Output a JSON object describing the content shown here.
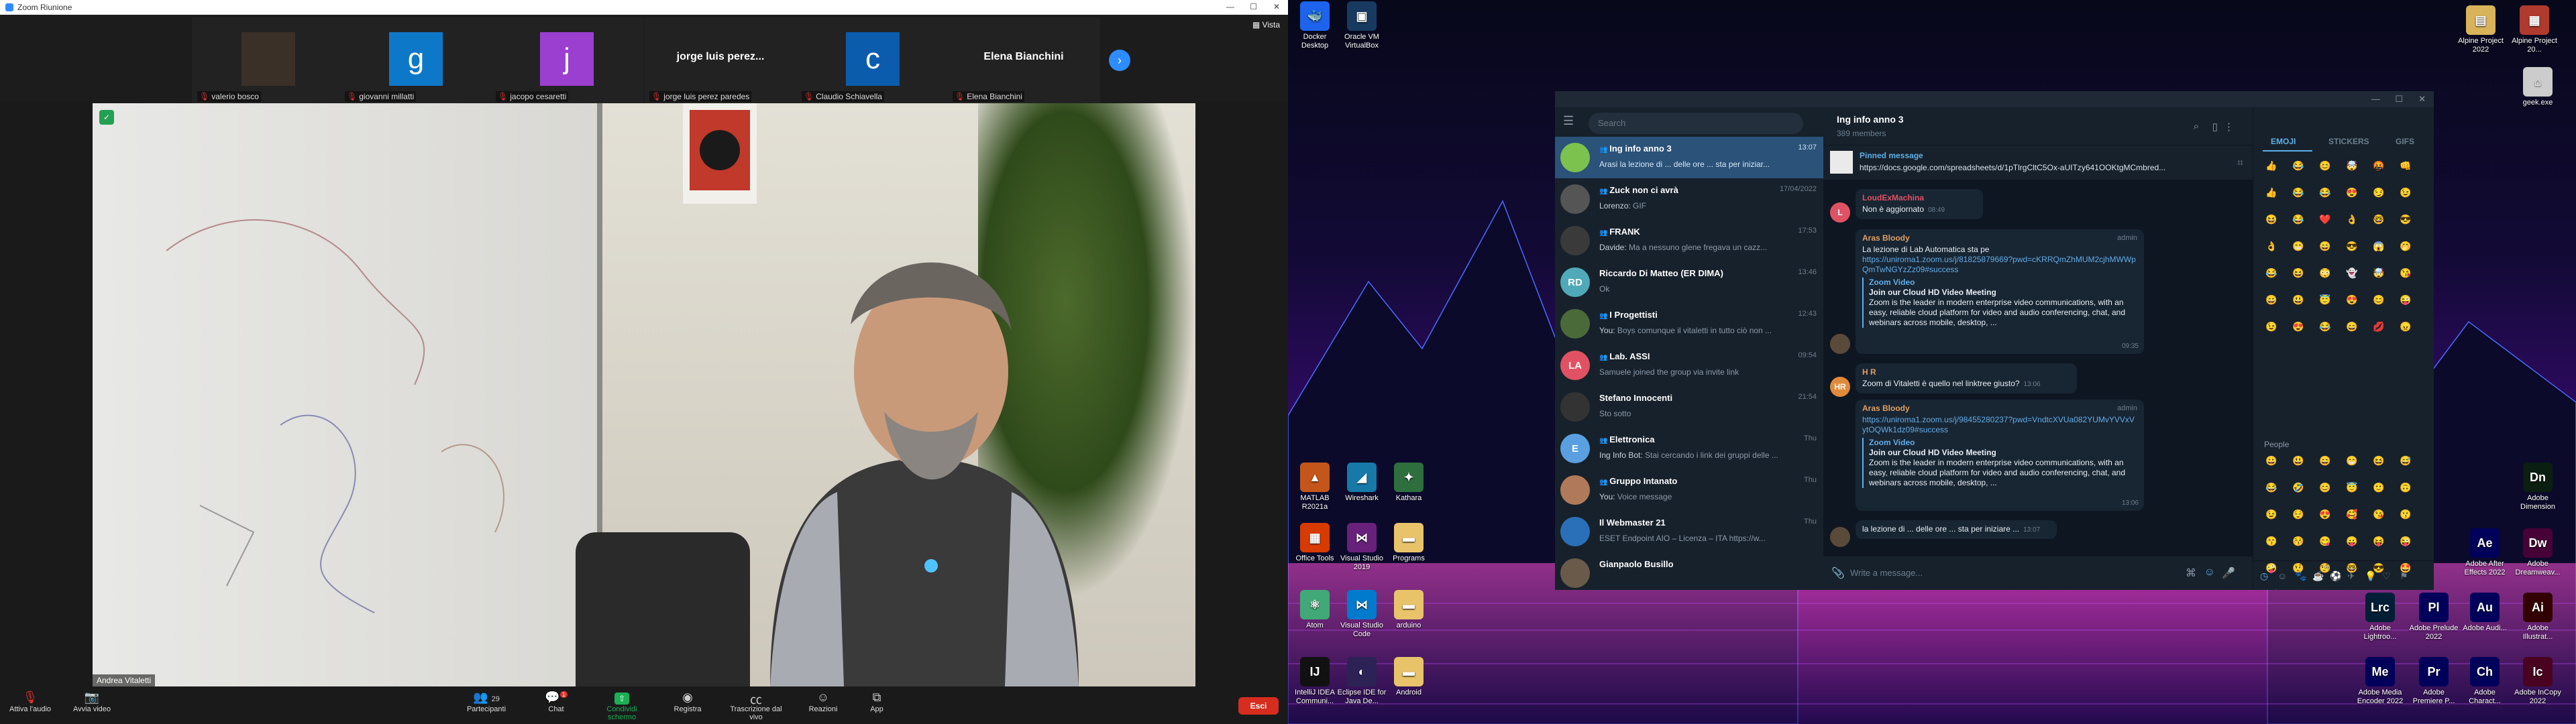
{
  "zoom": {
    "window_title": "Zoom Riunione",
    "view_label": "Vista",
    "participants": [
      {
        "name": "valerio bosco",
        "kind": "photo",
        "color": "#3a3028",
        "initial": ""
      },
      {
        "name": "giovanni millatti",
        "kind": "avatar",
        "color": "#0e78c8",
        "initial": "g"
      },
      {
        "name": "jacopo cesaretti",
        "kind": "avatar",
        "color": "#9b3fd1",
        "initial": "j"
      },
      {
        "name": "jorge luis perez paredes",
        "kind": "text",
        "big": "jorge  luis  perez...",
        "color": "#222"
      },
      {
        "name": "Claudio Schiavella",
        "kind": "avatar",
        "color": "#0b5cad",
        "initial": "c"
      },
      {
        "name": "Elena Bianchini",
        "kind": "text",
        "big": "Elena Bianchini",
        "color": "#222"
      }
    ],
    "speaker_name": "Andrea Vitaletti",
    "toolbar": {
      "audio": "Attiva l'audio",
      "video": "Avvia video",
      "participants": "Partecipanti",
      "participants_count": "29",
      "chat": "Chat",
      "chat_badge": "1",
      "share": "Condividi schermo",
      "record": "Registra",
      "transcript": "Trascrizione dal vivo",
      "reactions": "Reazioni",
      "apps": "App",
      "exit": "Esci"
    }
  },
  "desktop": {
    "icons_left": [
      {
        "label": "Docker Desktop",
        "glyph": "🐳",
        "color": "#1d63ed"
      },
      {
        "label": "Oracle VM VirtualBox",
        "glyph": "▣",
        "color": "#183a61"
      },
      {
        "label": "MATLAB R2021a",
        "glyph": "▲",
        "color": "#c4561b"
      },
      {
        "label": "Wireshark",
        "glyph": "◢",
        "color": "#1679a7"
      },
      {
        "label": "Kathara",
        "glyph": "✦",
        "color": "#2f6f3e"
      },
      {
        "label": "Office Tools",
        "glyph": "▦",
        "color": "#d83b01"
      },
      {
        "label": "Visual Studio 2019",
        "glyph": "⋈",
        "color": "#68217a"
      },
      {
        "label": "Programs",
        "glyph": "▬",
        "color": "#e8c36a"
      },
      {
        "label": "Atom",
        "glyph": "⚛",
        "color": "#40a977"
      },
      {
        "label": "Visual Studio Code",
        "glyph": "⋈",
        "color": "#007acc"
      },
      {
        "label": "arduino",
        "glyph": "▬",
        "color": "#e8c36a"
      },
      {
        "label": "IntelliJ IDEA Communi...",
        "glyph": "IJ",
        "color": "#111"
      },
      {
        "label": "Eclipse IDE for Java De...",
        "glyph": "◐",
        "color": "#2c2255"
      },
      {
        "label": "Android",
        "glyph": "▬",
        "color": "#e8c36a"
      }
    ],
    "icons_right": [
      {
        "label": "Alpine Project 2022",
        "glyph": "▤",
        "color": "#d9b35a"
      },
      {
        "label": "Alpine Project 20...",
        "glyph": "▦",
        "color": "#b03a2e"
      },
      {
        "label": "geek.exe",
        "glyph": "⌂",
        "color": "#ccc"
      },
      {
        "label": "Adobe Dimension",
        "glyph": "Dn",
        "color": "#0a1f0f"
      },
      {
        "label": "Adobe After Effects 2022",
        "glyph": "Ae",
        "color": "#00005b"
      },
      {
        "label": "Adobe Dreamweav...",
        "glyph": "Dw",
        "color": "#470137"
      },
      {
        "label": "Adobe Lightroo...",
        "glyph": "Lrc",
        "color": "#001e36"
      },
      {
        "label": "Adobe Prelude 2022",
        "glyph": "Pl",
        "color": "#00005b"
      },
      {
        "label": "Adobe Audi...",
        "glyph": "Au",
        "color": "#00005b"
      },
      {
        "label": "Adobe Illustrat...",
        "glyph": "Ai",
        "color": "#330000"
      },
      {
        "label": "Adobe Media Encoder 2022",
        "glyph": "Me",
        "color": "#00005b"
      },
      {
        "label": "Adobe Premiere P...",
        "glyph": "Pr",
        "color": "#00005b"
      },
      {
        "label": "Adobe Charact...",
        "glyph": "Ch",
        "color": "#00005b"
      },
      {
        "label": "Adobe InCopy 2022",
        "glyph": "Ic",
        "color": "#49021f"
      }
    ]
  },
  "telegram": {
    "search_placeholder": "Search",
    "chats": [
      {
        "title": "Ing info anno 3",
        "time": "13:07",
        "preview": "Arasi la lezione di ... delle ore ... sta per iniziar...",
        "sender": "",
        "color": "#7cc24e",
        "initial": "",
        "active": true,
        "group": true
      },
      {
        "title": "Zuck non ci avrà",
        "time": "17/04/2022",
        "sender": "Lorenzo:",
        "preview": " GIF",
        "color": "#555",
        "initial": "",
        "active": false,
        "group": true
      },
      {
        "title": "FRANK",
        "time": "17:53",
        "sender": "Davide:",
        "preview": " Ma a nessuno glene fregava un cazz...",
        "color": "#3a3a3a",
        "initial": "",
        "active": false,
        "group": true
      },
      {
        "title": "Riccardo Di Matteo (ER DIMA)",
        "time": "13:46",
        "sender": "",
        "preview": "Ok",
        "color": "#4fa9b8",
        "initial": "RD",
        "active": false,
        "group": false
      },
      {
        "title": "I Progettisti",
        "time": "12:43",
        "sender": "You:",
        "preview": " Boys comunque il vitaletti in tutto ciò non ...",
        "color": "#4a6a3a",
        "initial": "",
        "active": false,
        "group": true
      },
      {
        "title": "Lab. ASSI",
        "time": "09:54",
        "sender": "",
        "preview": "Samuele joined the group via invite link",
        "color": "#e05263",
        "initial": "LA",
        "active": false,
        "group": true
      },
      {
        "title": "Stefano Innocenti",
        "time": "21:54",
        "sender": "",
        "preview": "Sto sotto",
        "color": "#333",
        "initial": "",
        "active": false,
        "group": false
      },
      {
        "title": "Elettronica",
        "time": "Thu",
        "sender": "Ing Info Bot:",
        "preview": " Stai cercando i link dei gruppi delle ...",
        "color": "#5aa0e0",
        "initial": "E",
        "active": false,
        "group": true
      },
      {
        "title": "Gruppo Intanato",
        "time": "Thu",
        "sender": "You:",
        "preview": " Voice message",
        "color": "#b07a5a",
        "initial": "",
        "active": false,
        "group": true
      },
      {
        "title": "Il Webmaster 21",
        "time": "Thu",
        "sender": "",
        "preview": "ESET Endpoint AIO – Licenza – ITA https://w...",
        "color": "#2a70b8",
        "initial": "",
        "active": false,
        "group": false
      },
      {
        "title": "Gianpaolo Busillo",
        "time": "",
        "sender": "",
        "preview": "",
        "color": "#6a5a4a",
        "initial": "",
        "active": false,
        "group": false
      }
    ],
    "channel_name": "Ing info anno 3",
    "channel_members": "389 members",
    "pinned_label": "Pinned message",
    "pinned_text": "https://docs.google.com/spreadsheets/d/1pTlrgCltC5Ox-aUITzy641OOKtgMCmbred...",
    "messages": {
      "m1_sender": "LoudExMachina",
      "m1_text": "Non è aggiornato",
      "m1_time": "08:49",
      "m2_sender": "Aras Bloody",
      "m2_admin": "admin",
      "m2_text": "La lezione di Lab Automatica sta pe",
      "m2_link": "https://uniroma1.zoom.us/j/81825879669?pwd=cKRRQmZhMUM2cjhMWWpQmTwNGYzZz09#success",
      "m2_site": "Zoom Video",
      "m2_ptitle": "Join our Cloud HD Video Meeting",
      "m2_pdesc": "Zoom is the leader in modern enterprise video communications, with an easy, reliable cloud platform for video and audio conferencing, chat, and webinars across mobile, desktop, ...",
      "m2_time": "09:35",
      "m3_sender": "H R",
      "m3_text": "Zoom di Vitaletti è quello nel linktree giusto?",
      "m3_time": "13:06",
      "m4_sender": "Aras Bloody",
      "m4_admin": "admin",
      "m4_link": "https://uniroma1.zoom.us/j/98455280237?pwd=VndtcXVUa082YUMvYVVxVytOQWk1dz09#success",
      "m4_site": "Zoom Video",
      "m4_ptitle": "Join our Cloud HD Video Meeting",
      "m4_pdesc": "Zoom is the leader in modern enterprise video communications, with an easy, reliable cloud platform for video and audio conferencing, chat, and webinars across mobile, desktop, ...",
      "m4_time": "13:06",
      "m5_text": "la lezione di ... delle ore ... sta per iniziare ...",
      "m5_time": "13:07"
    },
    "composer_placeholder": "Write a message...",
    "panel_tabs": [
      "EMOJI",
      "STICKERS",
      "GIFS"
    ],
    "people_label": "People",
    "emoji_top": [
      "👍",
      "😂",
      "😊",
      "🤯",
      "🤬",
      "👊",
      "👍",
      "😂",
      "😂",
      "😍",
      "😏",
      "😉",
      "😆",
      "😂",
      "❤️",
      "👌",
      "🤓",
      "😎",
      "👌",
      "😁",
      "😄",
      "😎",
      "😱",
      "🤭",
      "😂",
      "😆",
      "😳",
      "👻",
      "🤯",
      "😘",
      "😄",
      "😃",
      "😇",
      "😍",
      "😊",
      "😜",
      "😉",
      "😍",
      "😂",
      "😄",
      "💋",
      "😠"
    ],
    "emoji_people": [
      "😀",
      "😃",
      "😄",
      "😁",
      "😆",
      "😅",
      "😂",
      "🤣",
      "😊",
      "😇",
      "🙂",
      "🙃",
      "😉",
      "😌",
      "😍",
      "🥰",
      "😘",
      "😗",
      "😙",
      "😚",
      "😋",
      "😛",
      "😝",
      "😜",
      "🤪",
      "🤨",
      "🧐",
      "🤓",
      "😎",
      "🤩",
      "🥳",
      "😏",
      "😒",
      "😞",
      "😔",
      "😟",
      "😕",
      "🙁",
      "☹️",
      "😣",
      "😖",
      "😫"
    ]
  }
}
